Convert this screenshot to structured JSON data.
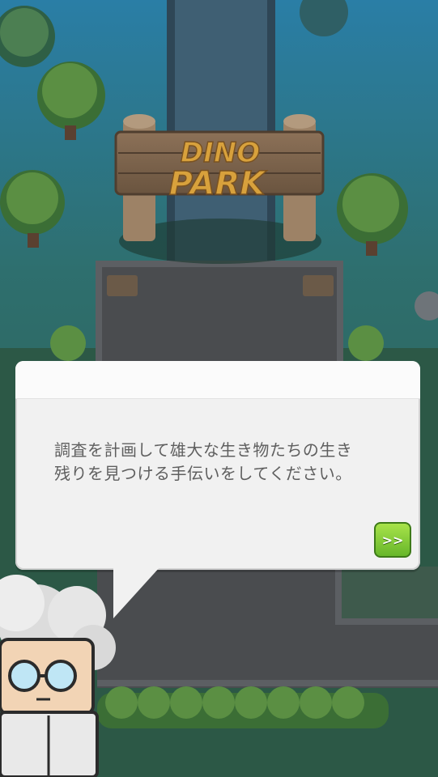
{
  "sign": {
    "line1": "DINO",
    "line2": "PARK"
  },
  "dialog": {
    "line1": "調査を計画して雄大な生き物たちの生き",
    "line2": "残りを見つける手伝いをしてください。",
    "next_label": ">>"
  },
  "colors": {
    "grass": "#2d5a4a",
    "path": "#4a4c4f",
    "bubble": "#f1f1f1",
    "button": "#7cc532"
  },
  "icons": [
    "dino-park-sign-icon",
    "tree-icon",
    "hedge-icon",
    "professor-avatar-icon",
    "double-chevron-right-icon"
  ]
}
